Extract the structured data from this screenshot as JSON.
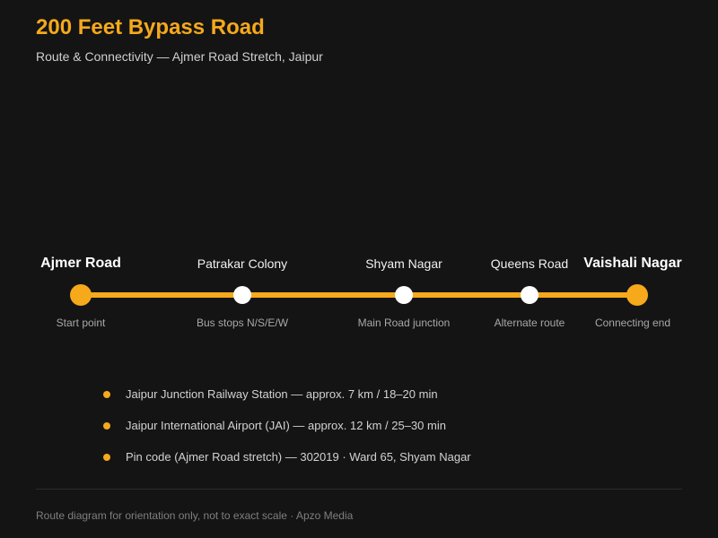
{
  "header": {
    "title": "200 Feet Bypass Road",
    "subtitle": "Route & Connectivity — Ajmer Road Stretch, Jaipur"
  },
  "route": {
    "stops": [
      {
        "name": "Ajmer Road",
        "note": "Start point",
        "major": true
      },
      {
        "name": "Patrakar Colony",
        "note": "Bus stops N/S/E/W",
        "major": false
      },
      {
        "name": "Shyam Nagar",
        "note": "Main Road junction",
        "major": false
      },
      {
        "name": "Queens Road",
        "note": "Alternate route",
        "major": false
      },
      {
        "name": "Vaishali Nagar",
        "note": "Connecting end",
        "major": true
      }
    ]
  },
  "facts": [
    "Jaipur Junction Railway Station — approx. 7 km / 18–20 min",
    "Jaipur International Airport (JAI) — approx. 12 km / 25–30 min",
    "Pin code (Ajmer Road stretch) — 302019 · Ward 65, Shyam Nagar"
  ],
  "footer": {
    "note": "Route diagram for orientation only, not to exact scale · Apzo Media"
  },
  "colors": {
    "accent": "#f5a91b",
    "background": "#141414"
  }
}
